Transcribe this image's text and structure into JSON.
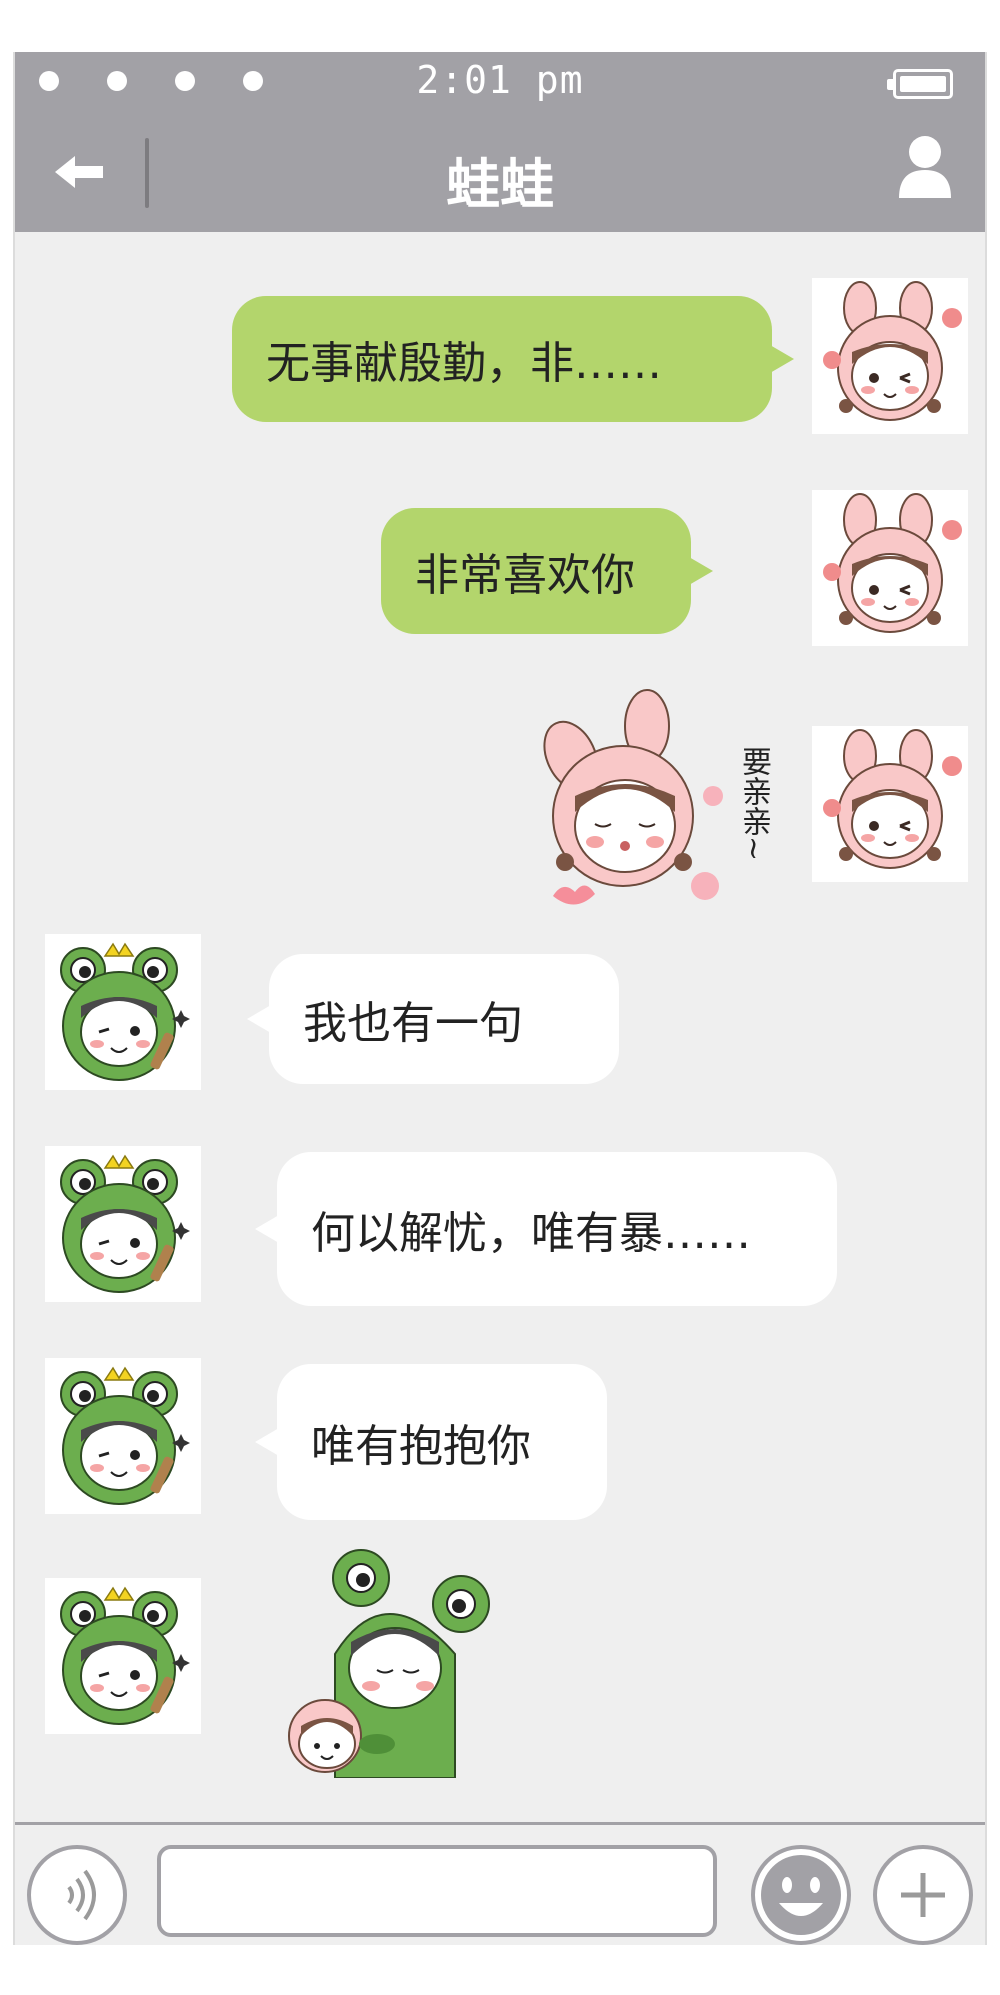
{
  "status_bar": {
    "time": "2:01 pm",
    "battery_level_percent": 100
  },
  "nav": {
    "title": "蛙蛙",
    "back_icon": "arrow-left-icon",
    "profile_icon": "user-icon"
  },
  "messages": [
    {
      "side": "right",
      "type": "text",
      "text": "无事献殷勤，非……"
    },
    {
      "side": "right",
      "type": "text",
      "text": "非常喜欢你"
    },
    {
      "side": "right",
      "type": "sticker",
      "sticker": "bunny-girl-kiss-sticker",
      "caption": "要亲亲~"
    },
    {
      "side": "left",
      "type": "text",
      "text": "我也有一句"
    },
    {
      "side": "left",
      "type": "text",
      "text": "何以解忧，唯有暴……"
    },
    {
      "side": "left",
      "type": "text",
      "text": "唯有抱抱你"
    },
    {
      "side": "left",
      "type": "sticker",
      "sticker": "frog-hugging-bunny-sticker"
    }
  ],
  "avatars": {
    "me": "bunny-girl-avatar",
    "contact": "frog-prince-avatar"
  },
  "input_bar": {
    "voice_icon": "voice-icon",
    "emoji_icon": "smile-icon",
    "add_icon": "plus-icon",
    "input_value": ""
  },
  "colors": {
    "bar": "#a2a1a6",
    "background": "#efefef",
    "my_bubble": "#b3d56c",
    "their_bubble": "#ffffff"
  }
}
